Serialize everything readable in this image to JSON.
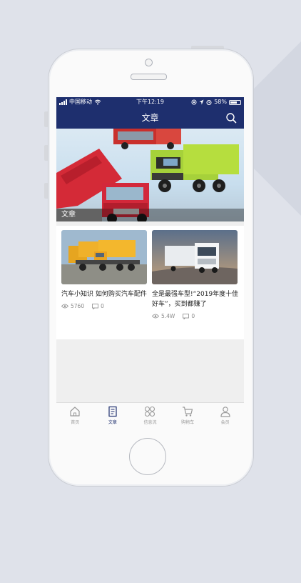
{
  "status_bar": {
    "carrier": "中国移动",
    "time": "下午12:19",
    "battery": "58%"
  },
  "nav": {
    "title": "文章",
    "search_icon": "search-icon"
  },
  "banner": {
    "label": "文章"
  },
  "articles": [
    {
      "title": "汽车小知识 如何购买汽车配件",
      "views": "5760",
      "comments": "0"
    },
    {
      "title": "全是最强车型!“2019年度十佳好车”，买到都赚了",
      "views": "5.4W",
      "comments": "0"
    }
  ],
  "tabs": [
    {
      "label": "首页",
      "icon": "home-icon"
    },
    {
      "label": "文章",
      "icon": "article-icon",
      "active": true
    },
    {
      "label": "信息流",
      "icon": "grid-icon"
    },
    {
      "label": "购物车",
      "icon": "cart-icon"
    },
    {
      "label": "会员",
      "icon": "user-icon"
    }
  ],
  "colors": {
    "accent": "#1e2f6e",
    "tab_inactive": "#9a9a9a"
  }
}
